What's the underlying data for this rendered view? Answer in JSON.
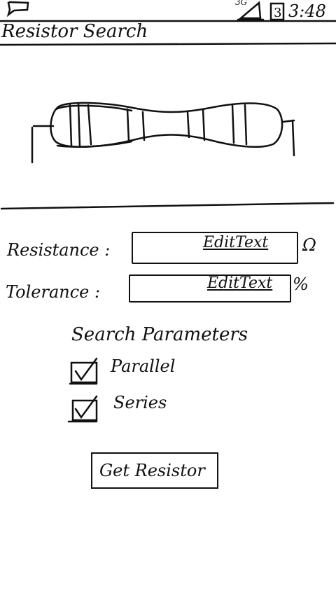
{
  "status_bar": {
    "signal_label": "3G",
    "battery_label": "3",
    "time": "3:48",
    "icons": [
      "chat-icon",
      "signal-icon",
      "battery-icon"
    ]
  },
  "app": {
    "title": "Resistor Search"
  },
  "form": {
    "resistance": {
      "label": "Resistance :",
      "value": "EditText",
      "unit": "Ω"
    },
    "tolerance": {
      "label": "Tolerance :",
      "value": "EditText",
      "unit": "%"
    }
  },
  "search_parameters": {
    "title": "Search Parameters",
    "options": [
      {
        "label": "Parallel",
        "checked": true
      },
      {
        "label": "Series",
        "checked": true
      }
    ]
  },
  "actions": {
    "get_resistor_label": "Get Resistor"
  }
}
